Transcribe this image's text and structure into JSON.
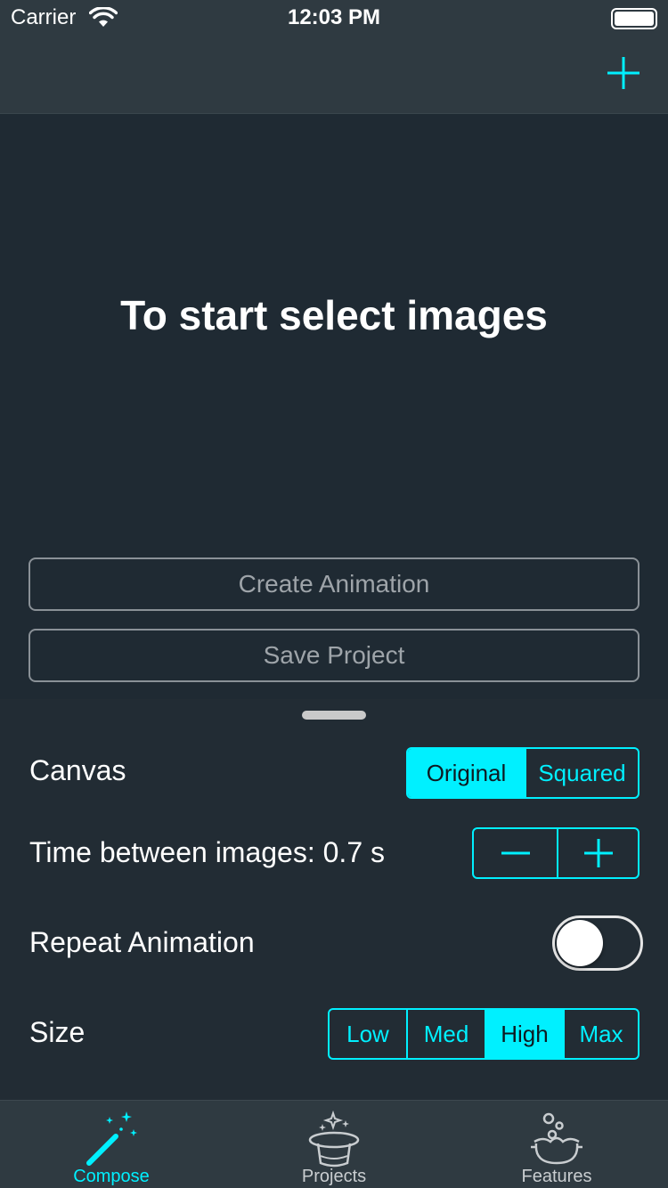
{
  "status_bar": {
    "carrier": "Carrier",
    "time": "12:03 PM"
  },
  "main": {
    "prompt": "To start select images",
    "create_animation": "Create Animation",
    "save_project": "Save Project"
  },
  "settings": {
    "canvas": {
      "label": "Canvas",
      "options": [
        "Original",
        "Squared"
      ],
      "selected": "Original"
    },
    "time": {
      "label": "Time between images: 0.7 s"
    },
    "repeat": {
      "label": "Repeat Animation",
      "on": false
    },
    "size": {
      "label": "Size",
      "options": [
        "Low",
        "Med",
        "High",
        "Max"
      ],
      "selected": "High"
    }
  },
  "tabs": [
    {
      "label": "Compose",
      "icon": "magic-wand-icon",
      "active": true
    },
    {
      "label": "Projects",
      "icon": "magic-hat-icon",
      "active": false
    },
    {
      "label": "Features",
      "icon": "cauldron-icon",
      "active": false
    }
  ],
  "colors": {
    "accent": "#00f0ff",
    "bar": "#2f3a41",
    "background": "#1f2a33",
    "inactive": "#c9cdd0"
  }
}
